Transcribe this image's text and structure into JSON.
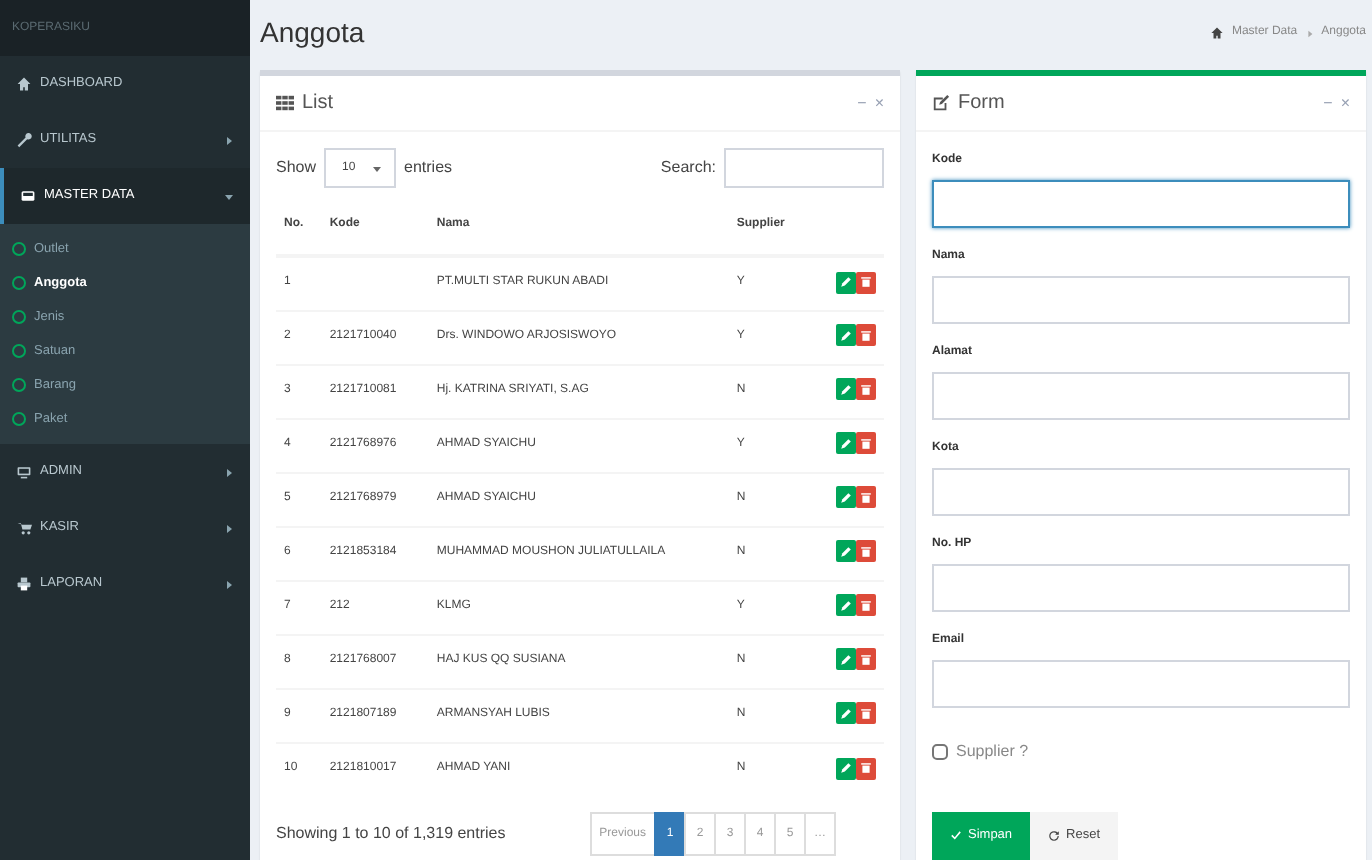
{
  "app": {
    "logo": "KOPERASIKU"
  },
  "sidebar": {
    "items": [
      {
        "label": "DASHBOARD",
        "selected": false
      },
      {
        "label": "UTILITAS",
        "expanded": false,
        "selected": false
      },
      {
        "label": "MASTER DATA",
        "expanded": true,
        "selected": true,
        "children": [
          {
            "label": "Outlet",
            "selected": false
          },
          {
            "label": "Anggota",
            "selected": true
          },
          {
            "label": "Jenis",
            "selected": false
          },
          {
            "label": "Satuan",
            "selected": false
          },
          {
            "label": "Barang",
            "selected": false
          },
          {
            "label": "Paket",
            "selected": false
          }
        ]
      },
      {
        "label": "ADMIN",
        "expanded": false,
        "selected": false
      },
      {
        "label": "KASIR",
        "expanded": false,
        "selected": false
      },
      {
        "label": "LAPORAN",
        "expanded": false,
        "selected": false
      }
    ]
  },
  "page": {
    "title": "Anggota",
    "breadcrumb": [
      "Master Data",
      "Anggota"
    ]
  },
  "list_panel": {
    "title": "List",
    "tools": [
      "−",
      "×"
    ],
    "show_label": "Show",
    "page_size": "10",
    "entries_label": "entries",
    "search_label": "Search:",
    "columns": [
      "No.",
      "Kode",
      "Nama",
      "Supplier"
    ],
    "rows": [
      {
        "no": "1",
        "nama": "PT.MULTI STAR RUKUN ABADI",
        "supplier": "Y"
      },
      {
        "no": "2",
        "kode": "2121710040",
        "nama": "Drs. WINDOWO ARJOSISWOYO",
        "supplier": "Y"
      },
      {
        "no": "3",
        "kode": "2121710081",
        "nama": "Hj. KATRINA SRIYATI, S.AG",
        "supplier": "N"
      },
      {
        "no": "4",
        "kode": "2121768976",
        "nama": "AHMAD SYAICHU",
        "supplier": "Y"
      },
      {
        "no": "5",
        "kode": "2121768979",
        "nama": "AHMAD SYAICHU",
        "supplier": "N"
      },
      {
        "no": "6",
        "kode": "2121853184",
        "nama": "MUHAMMAD MOUSHON JULIATULLAILA",
        "supplier": "N"
      },
      {
        "no": "7",
        "kode": "212",
        "nama": "KLMG",
        "supplier": "Y"
      },
      {
        "no": "8",
        "kode": "2121768007",
        "nama": "HAJ KUS QQ SUSIANA",
        "supplier": "N"
      },
      {
        "no": "9",
        "kode": "2121807189",
        "nama": "ARMANSYAH LUBIS",
        "supplier": "N"
      },
      {
        "no": "10",
        "kode": "2121810017",
        "nama": "AHMAD YANI",
        "supplier": "N"
      }
    ],
    "info": "Showing 1 to 10 of 1,319 entries",
    "pagination": {
      "previous": "Previous",
      "pages": [
        {
          "label": "1",
          "selected": true
        },
        {
          "label": "2",
          "selected": false
        },
        {
          "label": "3",
          "selected": false
        },
        {
          "label": "4",
          "selected": false
        },
        {
          "label": "5",
          "selected": false
        },
        {
          "label": "…",
          "selected": false
        }
      ]
    }
  },
  "form_panel": {
    "title": "Form",
    "tools": [
      "−",
      "×"
    ],
    "fields": [
      {
        "label": "Kode",
        "focused": true
      },
      {
        "label": "Nama",
        "focused": false
      },
      {
        "label": "Alamat",
        "focused": false
      },
      {
        "label": "Kota",
        "focused": false
      },
      {
        "label": "No. HP",
        "focused": false
      },
      {
        "label": "Email",
        "focused": false
      }
    ],
    "checkbox": {
      "label": "Supplier ?",
      "checked": false
    },
    "buttons": [
      {
        "kind": "save",
        "label": "Simpan"
      },
      {
        "kind": "reset",
        "label": "Reset"
      }
    ]
  }
}
